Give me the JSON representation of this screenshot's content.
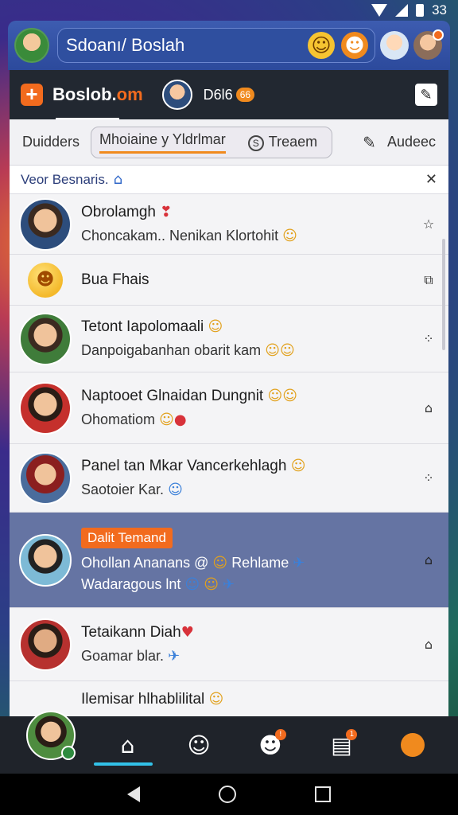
{
  "status_bar": {
    "time": "33"
  },
  "top_bar": {
    "title": "Sdoanı/ Boslah"
  },
  "subheader": {
    "brand_main": "Boslob.",
    "brand_accent": "om",
    "count_label": "D6l6",
    "count_badge": "66"
  },
  "tabs": {
    "tab1": "Duidders",
    "tab2": "Mhoiaine y Yldrlmar",
    "tab3": "Treaem",
    "tab4": "Audeec"
  },
  "search": {
    "text": "Veor Besnaris."
  },
  "chats": [
    {
      "name": "Obrolamgh",
      "name_emoji": "❣",
      "message": "Choncakam.. Nenikan Klortohit",
      "msg_emoji": "☺",
      "icon": "☆"
    },
    {
      "name": "Bua Fhais",
      "message": "",
      "icon": "⧉"
    },
    {
      "name": "Tetont Iapolomaali",
      "name_emoji": "☺",
      "message": "Danpoigabanhan obarit kam",
      "msg_emoji": "☺☺",
      "icon": "⁘"
    },
    {
      "name": "Naptooet Glnaidan Dungnit",
      "name_emoji": "☺☺",
      "message": "Ohomatiom",
      "msg_emoji": "☺",
      "msg_emoji2": "●",
      "icon": "⌂"
    },
    {
      "name": "Panel tan Mkar Vancerkehlagh",
      "name_emoji": "☺",
      "message": "Saotoier Kar.",
      "msg_emoji": "☺",
      "icon": "⁘"
    },
    {
      "tag": "Dalit Temand",
      "message": "Ohollan Ananans @",
      "message2": "Rehlame",
      "message3": "Wadaragous lnt",
      "icon": "⌂"
    },
    {
      "name": "Tetaikann Diah",
      "name_emoji": "♥",
      "message": "Goamar blar.",
      "msg_emoji": "✈",
      "icon": "⌂"
    },
    {
      "name": "Ilemisar hlhablilital",
      "name_emoji": "☺",
      "message": "",
      "icon": ""
    }
  ],
  "bottom_nav": {
    "badge_bubble": "!",
    "badge_doc": "1"
  },
  "colors": {
    "accent": "#f26b1e",
    "header_blue": "#2f4f9f",
    "highlight": "#6574a3"
  }
}
